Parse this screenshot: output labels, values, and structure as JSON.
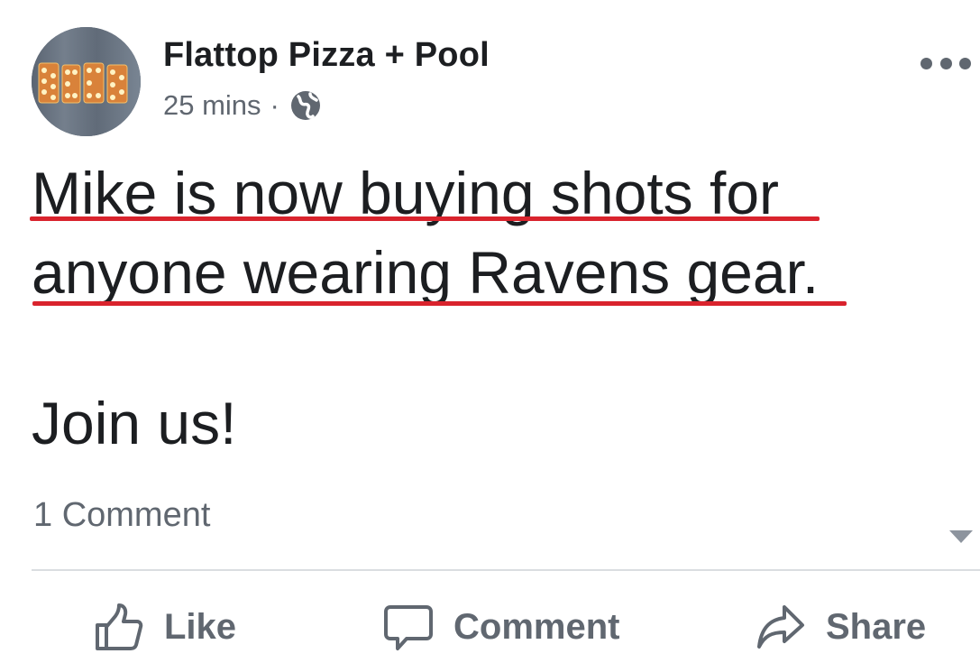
{
  "post": {
    "author": "Flattop Pizza + Pool",
    "timestamp": "25 mins",
    "separator": "·",
    "privacy_icon": "globe-icon",
    "avatar_sign_text": "BEER",
    "more_icon": "more-horizontal-icon",
    "text_lines": [
      "Mike is now buying shots for",
      "anyone wearing Ravens gear."
    ],
    "text_followup": "Join us!",
    "underline_color": "#d9232d"
  },
  "stats": {
    "comments": "1 Comment"
  },
  "actions": {
    "like": "Like",
    "comment": "Comment",
    "share": "Share"
  },
  "colors": {
    "text": "#1c1e21",
    "secondary": "#606770",
    "divider": "#dadde1"
  }
}
